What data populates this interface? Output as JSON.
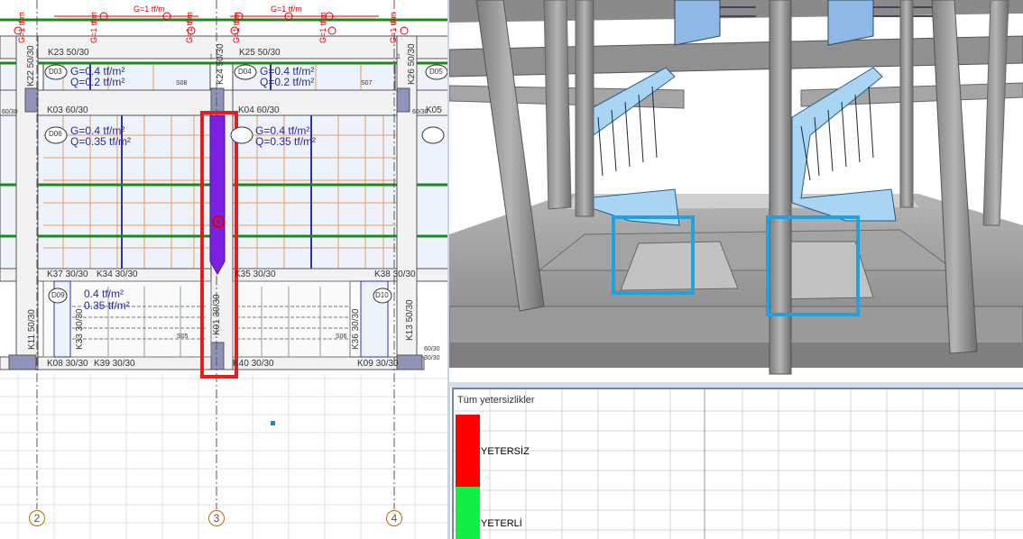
{
  "plan": {
    "beams_top": [
      "K23 50/30",
      "K25 50/30"
    ],
    "beams_mid": [
      "K03 60/30",
      "K04 60/30",
      "K05"
    ],
    "beams_low": [
      "K37 30/30",
      "K34 30/30",
      "K35 30/30",
      "K38 30/30"
    ],
    "beams_bottom": [
      "K08 30/30",
      "K39 30/30",
      "K40 30/30",
      "K09 30/30"
    ],
    "columns": [
      "K22 50/30",
      "K24 50/30",
      "K26 50/30",
      "K11 50/30",
      "K13 50/30",
      "K33 30/30",
      "K36 30/30",
      "K01 30/30"
    ],
    "slabs": [
      "D03",
      "D04",
      "D05",
      "D06",
      "D09",
      "D10"
    ],
    "slab_small": [
      "S08",
      "S07",
      "S05",
      "S06"
    ],
    "loads_upper_left": [
      "G=0.4 tf/m²",
      "Q=0.2 tf/m²"
    ],
    "loads_upper_right": [
      "G=0.4 tf/m²",
      "Q=0.2 tf/m²"
    ],
    "loads_mid_left": [
      "G=0.4 tf/m²",
      "Q=0.35 tf/m²"
    ],
    "loads_mid_right": [
      "G=0.4 tf/m²",
      "Q=0.35 tf/m²"
    ],
    "loads_stair_left": [
      "0.4 tf/m²",
      "0.35 tf/m²"
    ],
    "line_loads_horizontal": [
      "G=1 tf/m",
      "G=1 tf/m"
    ],
    "line_loads_vertical": [
      "G=1 tf/m",
      "G=1 tf/m",
      "G=1 tf/m",
      "G=1 tf/m",
      "G=1 tf/m",
      "G=1 tf/m"
    ],
    "axes": [
      "2",
      "3",
      "4"
    ],
    "small_tags": [
      "1",
      "1",
      "60/30",
      "60/30",
      "60/30",
      "30/30"
    ],
    "colors": {
      "highlight": "#e02020",
      "selected": "#7a22e0",
      "grid": "#c8c8c8"
    }
  },
  "panel": {
    "title": "Tüm yetersizlikler",
    "legend": [
      {
        "label": "YETERSİZ",
        "color": "#ff0000"
      },
      {
        "label": "YETERLİ",
        "color": "#11ee44"
      }
    ]
  },
  "view3d": {
    "highlight_color": "#1fa3e0"
  }
}
